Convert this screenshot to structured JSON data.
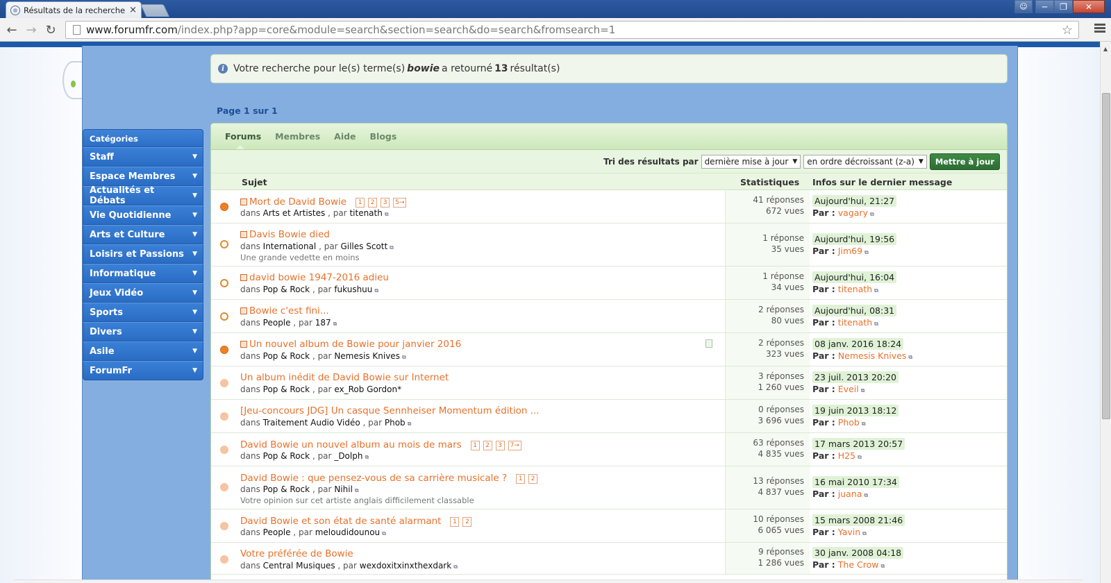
{
  "browser": {
    "tab_title": "Résultats de la recherche -",
    "tab_close": "×",
    "url_host": "www.forumfr.com",
    "url_path": "/index.php?app=core&module=search&section=search&do=search&fromsearch=1"
  },
  "message": {
    "prefix": "Votre recherche pour le(s) terme(s)",
    "term": "bowie",
    "middle": "a retourné",
    "count": "13",
    "suffix": "résultat(s)"
  },
  "pagination": {
    "label": "Page 1 sur 1"
  },
  "sidebar": {
    "header": "Catégories",
    "items": [
      {
        "label": "Staff"
      },
      {
        "label": "Espace Membres"
      },
      {
        "label": "Actualités et Débats"
      },
      {
        "label": "Vie Quotidienne"
      },
      {
        "label": "Arts et Culture"
      },
      {
        "label": "Loisirs et Passions"
      },
      {
        "label": "Informatique"
      },
      {
        "label": "Jeux Vidéo"
      },
      {
        "label": "Sports"
      },
      {
        "label": "Divers"
      },
      {
        "label": "Asile"
      },
      {
        "label": "ForumFr"
      }
    ]
  },
  "tabs": [
    "Forums",
    "Membres",
    "Aide",
    "Blogs"
  ],
  "sort": {
    "label": "Tri des résultats par",
    "field": "dernière mise à jour",
    "order": "en ordre décroissant (z-a)",
    "button": "Mettre à jour"
  },
  "columns": {
    "subject": "Sujet",
    "stats": "Statistiques",
    "last": "Infos sur le dernier message"
  },
  "labels": {
    "in": "dans",
    "by": ", par",
    "par": "Par :"
  },
  "rows": [
    {
      "title": "Mort de David Bowie",
      "status": "hot",
      "topic_icon": true,
      "pages": [
        "1",
        "2",
        "3",
        "5→"
      ],
      "forum": "Arts et Artistes",
      "author": "titenath",
      "author_link": true,
      "desc": "",
      "replies": "41 réponses",
      "views": "672 vues",
      "last_date": "Aujourd'hui, 21:27",
      "last_by": "vagary",
      "attach": false
    },
    {
      "title": "Davis Bowie died",
      "status": "ring",
      "topic_icon": true,
      "pages": [],
      "forum": "International",
      "author": "Gilles Scott",
      "author_link": true,
      "desc": "Une grande vedette en moins",
      "replies": "1 réponse",
      "views": "35 vues",
      "last_date": "Aujourd'hui, 19:56",
      "last_by": "Jim69",
      "attach": false
    },
    {
      "title": "david bowie 1947-2016 adieu",
      "status": "ring",
      "topic_icon": true,
      "pages": [],
      "forum": "Pop & Rock",
      "author": "fukushuu",
      "author_link": true,
      "desc": "",
      "replies": "1 réponse",
      "views": "34 vues",
      "last_date": "Aujourd'hui, 16:04",
      "last_by": "titenath",
      "attach": false
    },
    {
      "title": "Bowie c'est fini...",
      "status": "ring",
      "topic_icon": true,
      "pages": [],
      "forum": "People",
      "author": "187",
      "author_link": true,
      "desc": "",
      "replies": "2 réponses",
      "views": "80 vues",
      "last_date": "Aujourd'hui, 08:31",
      "last_by": "titenath",
      "attach": false
    },
    {
      "title": "Un nouvel album de Bowie pour janvier 2016",
      "status": "hot",
      "topic_icon": true,
      "pages": [],
      "forum": "Pop & Rock",
      "author": "Nemesis Knives",
      "author_link": true,
      "desc": "",
      "replies": "2 réponses",
      "views": "323 vues",
      "last_date": "08 janv. 2016 18:24",
      "last_by": "Nemesis Knives",
      "attach": true
    },
    {
      "title": "Un album inédit de David Bowie sur Internet",
      "status": "faded",
      "topic_icon": false,
      "pages": [],
      "forum": "Pop & Rock",
      "author": "ex_Rob Gordon*",
      "author_link": false,
      "desc": "",
      "replies": "3 réponses",
      "views": "1 260 vues",
      "last_date": "23 juil. 2013 20:20",
      "last_by": "Eveil",
      "attach": false
    },
    {
      "title": "[Jeu-concours JDG] Un casque Sennheiser Momentum édition ...",
      "status": "faded",
      "topic_icon": false,
      "pages": [],
      "forum": "Traitement Audio Vidéo",
      "author": "Phob",
      "author_link": true,
      "desc": "",
      "replies": "0 réponses",
      "views": "3 696 vues",
      "last_date": "19 juin 2013 18:12",
      "last_by": "Phob",
      "attach": false
    },
    {
      "title": "David Bowie un nouvel album au mois de mars",
      "status": "faded",
      "topic_icon": false,
      "pages": [
        "1",
        "2",
        "3",
        "7→"
      ],
      "forum": "Pop & Rock",
      "author": "_Dolph",
      "author_link": true,
      "desc": "",
      "replies": "63 réponses",
      "views": "4 835 vues",
      "last_date": "17 mars 2013 20:57",
      "last_by": "H25",
      "attach": false
    },
    {
      "title": "David Bowie : que pensez-vous de sa carrière musicale ?",
      "status": "faded",
      "topic_icon": false,
      "pages": [
        "1",
        "2"
      ],
      "forum": "Pop & Rock",
      "author": "Nihil",
      "author_link": true,
      "desc": "Votre opinion sur cet artiste anglais difficilement classable",
      "replies": "13 réponses",
      "views": "4 837 vues",
      "last_date": "16 mai 2010 17:34",
      "last_by": "juana",
      "attach": false
    },
    {
      "title": "David Bowie et son état de santé alarmant",
      "status": "faded",
      "topic_icon": false,
      "pages": [
        "1",
        "2"
      ],
      "forum": "People",
      "author": "meloudidounou",
      "author_link": true,
      "desc": "",
      "replies": "10 réponses",
      "views": "6 065 vues",
      "last_date": "15 mars 2008 21:46",
      "last_by": "Yavin",
      "attach": false
    },
    {
      "title": "Votre préférée de Bowie",
      "status": "faded",
      "topic_icon": false,
      "pages": [],
      "forum": "Central Musiques",
      "author": "wexdoxitxinxthexdark",
      "author_link": true,
      "desc": "",
      "replies": "9 réponses",
      "views": "1 286 vues",
      "last_date": "30 janv. 2008 04:18",
      "last_by": "The Crow",
      "attach": false
    }
  ]
}
